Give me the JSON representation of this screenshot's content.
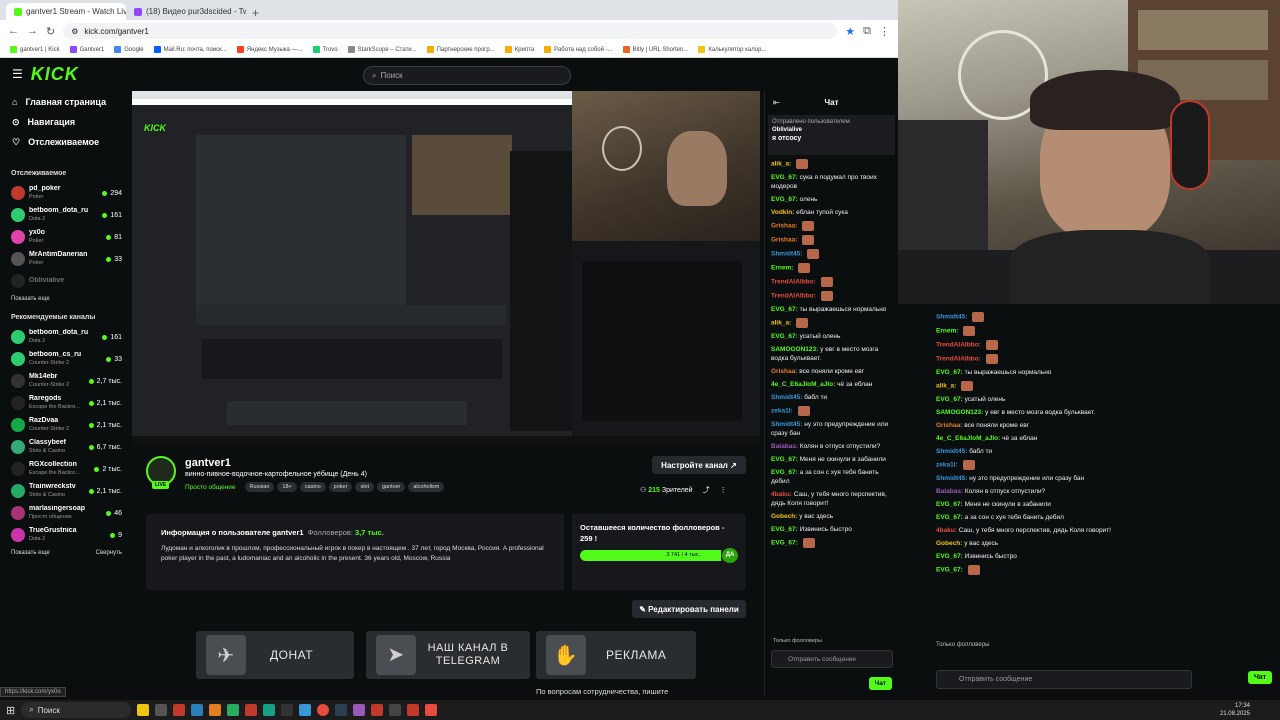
{
  "browser": {
    "tabs": [
      {
        "label": "gantver1 Stream - Watch Live o"
      },
      {
        "label": "(18) Видео pur3dscided - Twi"
      }
    ],
    "url": "kick.com/gantver1",
    "bookmarks": [
      "gantver1 | Kick",
      "Gantver1",
      "Google",
      "Mail.Ru: почта, поиск...",
      "Яндекс Музыка —...",
      "Trovo",
      "StarkScope – Стати...",
      "Партнерские прогр...",
      "Крипта",
      "Работа над собой -...",
      "Bitly | URL Shorten...",
      "Калькулятор калор..."
    ]
  },
  "header": {
    "logo": "KICK",
    "search_placeholder": "Поиск"
  },
  "sidebar": {
    "nav": [
      {
        "label": "Главная страница"
      },
      {
        "label": "Навигация"
      },
      {
        "label": "Отслеживаемое"
      }
    ],
    "followed_title": "Отслеживаемое",
    "followed": [
      {
        "name": "pd_poker",
        "category": "Poker",
        "viewers": "294",
        "color": "#c0392b"
      },
      {
        "name": "betboom_dota_ru",
        "category": "Dota 2",
        "viewers": "161",
        "color": "#2ecc71"
      },
      {
        "name": "yx0o",
        "category": "Poker",
        "viewers": "81",
        "color": "#d4a"
      },
      {
        "name": "MrAntimDanerian",
        "category": "Poker",
        "viewers": "33",
        "color": "#555"
      },
      {
        "name": "Oblivialive",
        "category": "",
        "viewers": "",
        "color": "#444"
      }
    ],
    "show_all": "Показать еще",
    "recommended_title": "Рекомендуемые каналы",
    "recommended": [
      {
        "name": "betboom_dota_ru",
        "category": "Dota 2",
        "viewers": "161",
        "color": "#2ecc71"
      },
      {
        "name": "betboom_cs_ru",
        "category": "Counter-Strike 2",
        "viewers": "33",
        "color": "#2ecc71"
      },
      {
        "name": "Mk14ebr",
        "category": "Counter-Strike 2",
        "viewers": "2,7 тыс.",
        "color": "#333"
      },
      {
        "name": "Raregods",
        "category": "Escape the Backro...",
        "viewers": "2,1 тыс.",
        "color": "#222"
      },
      {
        "name": "RazDvaa",
        "category": "Counter-Strike 2",
        "viewers": "2,1 тыс.",
        "color": "#1a4"
      },
      {
        "name": "Classybeef",
        "category": "Slots & Casino",
        "viewers": "6,7 тыс.",
        "color": "#3a7"
      },
      {
        "name": "RGXcollection",
        "category": "Escape the Backro...",
        "viewers": "2 тыс.",
        "color": "#222"
      },
      {
        "name": "Trainwreckstv",
        "category": "Slots & Casino",
        "viewers": "2,1 тыс.",
        "color": "#2a6"
      },
      {
        "name": "marlasingersoap",
        "category": "Просто общение",
        "viewers": "46",
        "color": "#a37"
      },
      {
        "name": "TrueGrustnica",
        "category": "Dota 2",
        "viewers": "9",
        "color": "#c3a"
      }
    ],
    "show_more": "Показать еще",
    "collapse": "Свернуть"
  },
  "channel": {
    "name": "gantver1",
    "live": "LIVE",
    "title": "винно-пивное-водочное-картофельное уёбище (День 4)",
    "category": "Просто общение",
    "tags": [
      "Russian",
      "18+",
      "casino",
      "poker",
      "slot",
      "gantver",
      "alcoholism"
    ],
    "setup_button": "Настройте канал",
    "viewers": "215",
    "viewers_label": "Зрителей"
  },
  "about": {
    "title": "Информация о пользователе gantver1",
    "followers_label": "Фолловеров:",
    "followers": "3,7 тыс.",
    "text": "Лудоман и алкоголик в прошлом, профессиональный игрок в покер в настоящем . 37 лет, город Москва, Россия. A professional poker player in the past, a ludomaniac and an alcoholic in the present. 36 years old, Moscow, Russia"
  },
  "goal": {
    "title": "Оставшееся количество фолловеров - 259 !",
    "progress_text": "3 741 / 4 тыс.",
    "badge": "ДА",
    "progress": 0.935
  },
  "edit_panels": "Редактировать панели",
  "panels": [
    {
      "label": "ДОНАТ",
      "icon": "✈"
    },
    {
      "label": "НАШ КАНАЛ В TELEGRAM",
      "icon": "➤"
    },
    {
      "label": "РЕКЛАМА",
      "icon": "✋"
    }
  ],
  "contact_text": "По вопросам сотрудничества, пишите",
  "status_url": "https://kick.com/yx0o",
  "chat": {
    "title": "Чат",
    "pinned_label": "Отправлено пользователем",
    "pinned_user": "Oblivialive",
    "pinned_text": "я отсосу",
    "messages": [
      {
        "user": "alik_a:",
        "text": "",
        "color": "#f1c40f"
      },
      {
        "user": "EVG_67:",
        "text": "сука я подумал про твоих модеров",
        "color": "#53fc18"
      },
      {
        "user": "EVG_67:",
        "text": "олень",
        "color": "#53fc18"
      },
      {
        "user": "Vodkin:",
        "text": "еблан тупой сука",
        "color": "#f1c40f"
      },
      {
        "user": "Grishaa:",
        "text": "",
        "color": "#e67e22"
      },
      {
        "user": "Grishaa:",
        "text": "",
        "color": "#e67e22"
      },
      {
        "user": "Shmidt45:",
        "text": "",
        "color": "#3498db"
      },
      {
        "user": "Ernem:",
        "text": "",
        "color": "#53fc18"
      },
      {
        "user": "TrendAIAIbbo:",
        "text": "",
        "color": "#e74c3c"
      },
      {
        "user": "TrendAIAIbbo:",
        "text": "",
        "color": "#e74c3c"
      },
      {
        "user": "EVG_67:",
        "text": "ты выражаешься нормально",
        "color": "#53fc18"
      },
      {
        "user": "alik_a:",
        "text": "",
        "color": "#f1c40f"
      },
      {
        "user": "EVG_67:",
        "text": "усатый олень",
        "color": "#53fc18"
      },
      {
        "user": "SAMOGON123:",
        "text": "у евг в место мозга водка бульквает.",
        "color": "#53fc18"
      },
      {
        "user": "Grishaa:",
        "text": "все поняли кроме евг",
        "color": "#e67e22"
      },
      {
        "user": "4e_C_E6aJloM_aJlo:",
        "text": "чё за еблан",
        "color": "#53fc18"
      },
      {
        "user": "Shmidt45:",
        "text": "бабл ти",
        "color": "#3498db"
      },
      {
        "user": "zeka1l:",
        "text": "",
        "color": "#3498db"
      },
      {
        "user": "Shmidt45:",
        "text": "ну это предупреждение или сразу бан",
        "color": "#3498db"
      },
      {
        "user": "Balabas:",
        "text": "Колян в отпуск отпустили?",
        "color": "#9b59b6"
      },
      {
        "user": "EVG_67:",
        "text": "Меня не скинули в забанили",
        "color": "#53fc18"
      },
      {
        "user": "EVG_67:",
        "text": "а за сон с хуя тебя банить дебил",
        "color": "#53fc18"
      },
      {
        "user": "4baku:",
        "text": "Саш, у тебя много перспектив, дядь Коля говорит!",
        "color": "#e74c3c"
      },
      {
        "user": "Gobech:",
        "text": "у вас здесь",
        "color": "#f1c40f"
      },
      {
        "user": "EVG_67:",
        "text": "Извинись быстро",
        "color": "#53fc18"
      },
      {
        "user": "EVG_67:",
        "text": "",
        "color": "#53fc18"
      }
    ],
    "followers_only": "Только фолловеры",
    "input_placeholder": "Отправить сообщение",
    "send_button": "Чат"
  },
  "bigchat": {
    "messages": [
      {
        "user": "Shmidt45:",
        "text": "",
        "color": "#3498db"
      },
      {
        "user": "Ernem:",
        "text": "",
        "color": "#53fc18"
      },
      {
        "user": "TrendAIAIbbo:",
        "text": "",
        "color": "#e74c3c"
      },
      {
        "user": "TrendAIAIbbo:",
        "text": "",
        "color": "#e74c3c"
      },
      {
        "user": "EVG_67:",
        "text": "ты выражаешься нормально",
        "color": "#53fc18"
      },
      {
        "user": "alik_a:",
        "text": "",
        "color": "#f1c40f"
      },
      {
        "user": "EVG_67:",
        "text": "усатый олень",
        "color": "#53fc18"
      },
      {
        "user": "SAMOGON123:",
        "text": "у евг в место мозга водка бульквает.",
        "color": "#53fc18"
      },
      {
        "user": "Grishaa:",
        "text": "все поняли кроме евг",
        "color": "#e67e22"
      },
      {
        "user": "4e_C_E6aJloM_aJlo:",
        "text": "чё за еблан",
        "color": "#53fc18"
      },
      {
        "user": "Shmidt45:",
        "text": "бабл ти",
        "color": "#3498db"
      },
      {
        "user": "zeka1l:",
        "text": "",
        "color": "#3498db"
      },
      {
        "user": "Shmidt45:",
        "text": "ну это предупреждение или сразу бан",
        "color": "#3498db"
      },
      {
        "user": "Balabas:",
        "text": "Колян в отпуск отпустили?",
        "color": "#9b59b6"
      },
      {
        "user": "EVG_67:",
        "text": "Меня не скинули в забанили",
        "color": "#53fc18"
      },
      {
        "user": "EVG_67:",
        "text": "а за сон с хуя тебя банить дебил",
        "color": "#53fc18"
      },
      {
        "user": "4baku:",
        "text": "Саш, у тебя много перспектив, дядь Коля говорит!",
        "color": "#e74c3c"
      },
      {
        "user": "Gobech:",
        "text": "у вас здесь",
        "color": "#f1c40f"
      },
      {
        "user": "EVG_67:",
        "text": "Извинись быстро",
        "color": "#53fc18"
      },
      {
        "user": "EVG_67:",
        "text": "",
        "color": "#53fc18"
      }
    ],
    "followers_only": "Только фолловеры",
    "input_placeholder": "Отправить сообщение",
    "send_button": "Чат"
  },
  "taskbar": {
    "search": "Поиск",
    "time": "17:34",
    "date": "21.08.2025"
  }
}
